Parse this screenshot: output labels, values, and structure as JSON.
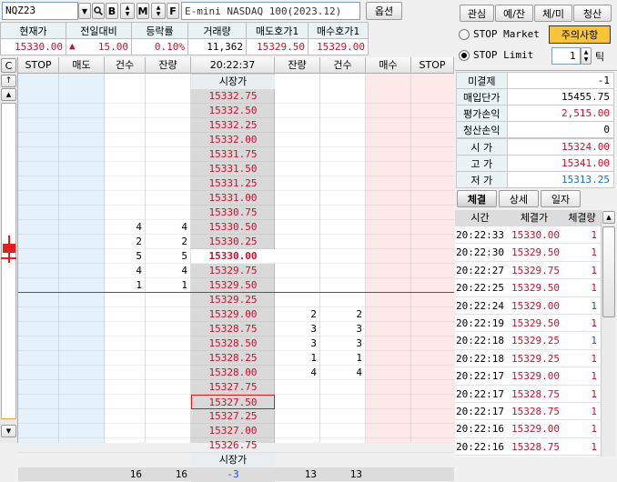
{
  "toolbar": {
    "symbol": "NQZ23",
    "name": "E-mini NASDAQ 100(2023.12)",
    "options_label": "옵션",
    "btn_b": "B",
    "btn_m": "M",
    "btn_f": "F"
  },
  "quote": {
    "headers": [
      "현재가",
      "전일대비",
      "등락률",
      "거래량",
      "매도호가1",
      "매수호가1"
    ],
    "current": "15330.00",
    "change": "15.00",
    "change_dir_icon": "up-triangle-icon",
    "rate": "0.10%",
    "volume": "11,362",
    "ask1": "15329.50",
    "bid1": "15329.00"
  },
  "ladder": {
    "corner": "C",
    "time": "20:22:37",
    "headers": [
      "STOP",
      "매도",
      "건수",
      "잔량",
      "",
      "잔량",
      "건수",
      "매수",
      "STOP"
    ],
    "market_label": "시장가",
    "prices": [
      "15332.75",
      "15332.50",
      "15332.25",
      "15332.00",
      "15331.75",
      "15331.50",
      "15331.25",
      "15331.00",
      "15330.75",
      "15330.50",
      "15330.25",
      "15330.00",
      "15329.75",
      "15329.50",
      "15329.25",
      "15329.00",
      "15328.75",
      "15328.50",
      "15328.25",
      "15328.00",
      "15327.75",
      "15327.50",
      "15327.25",
      "15327.00",
      "15326.75"
    ],
    "ask_rows": [
      {
        "row": 9,
        "count": "4",
        "qty": "4"
      },
      {
        "row": 10,
        "count": "2",
        "qty": "2"
      },
      {
        "row": 11,
        "count": "5",
        "qty": "5"
      },
      {
        "row": 12,
        "count": "4",
        "qty": "4"
      },
      {
        "row": 13,
        "count": "1",
        "qty": "1"
      }
    ],
    "bid_rows": [
      {
        "row": 15,
        "qty": "2",
        "count": "2"
      },
      {
        "row": 16,
        "qty": "3",
        "count": "3"
      },
      {
        "row": 17,
        "qty": "3",
        "count": "3"
      },
      {
        "row": 18,
        "qty": "1",
        "count": "1"
      },
      {
        "row": 19,
        "qty": "4",
        "count": "4"
      }
    ],
    "current_row": 11,
    "highlight_row": 21,
    "totals": {
      "ask_count": "16",
      "ask_qty": "16",
      "net": "-3",
      "bid_qty": "13",
      "bid_count": "13"
    }
  },
  "side": {
    "tabs": [
      "관심",
      "예/잔",
      "체/미",
      "청산"
    ],
    "stop_market": "STOP Market",
    "stop_limit": "STOP Limit",
    "notice": "주의사항",
    "tick_value": "1",
    "tick_label": "틱",
    "account": [
      {
        "label": "미결제",
        "value": "-1",
        "color": "#000000"
      },
      {
        "label": "매입단가",
        "value": "15455.75",
        "color": "#000000"
      },
      {
        "label": "평가손익",
        "value": "2,515.00",
        "color": "#c8102e"
      },
      {
        "label": "청산손익",
        "value": "0",
        "color": "#000000"
      }
    ],
    "ohl": [
      {
        "label": "시 가",
        "value": "15324.00",
        "color": "#c8102e"
      },
      {
        "label": "고 가",
        "value": "15341.00",
        "color": "#c8102e"
      },
      {
        "label": "저 가",
        "value": "15313.25",
        "color": "#1a6fb0"
      }
    ],
    "trade_tabs": [
      "체결",
      "상세",
      "일자"
    ],
    "trade_headers": [
      "시간",
      "체결가",
      "체결량"
    ],
    "trades": [
      {
        "time": "20:22:33",
        "price": "15330.00",
        "qty": "1",
        "qcolor": "#c8102e"
      },
      {
        "time": "20:22:30",
        "price": "15329.50",
        "qty": "1",
        "qcolor": "#c8102e"
      },
      {
        "time": "20:22:27",
        "price": "15329.75",
        "qty": "1",
        "qcolor": "#c8102e"
      },
      {
        "time": "20:22:25",
        "price": "15329.50",
        "qty": "1",
        "qcolor": "#c8102e"
      },
      {
        "time": "20:22:24",
        "price": "15329.00",
        "qty": "1",
        "qcolor": "#1a4fd6"
      },
      {
        "time": "20:22:19",
        "price": "15329.50",
        "qty": "1",
        "qcolor": "#c8102e"
      },
      {
        "time": "20:22:18",
        "price": "15329.25",
        "qty": "1",
        "qcolor": "#1a4fd6"
      },
      {
        "time": "20:22:18",
        "price": "15329.25",
        "qty": "1",
        "qcolor": "#c8102e"
      },
      {
        "time": "20:22:17",
        "price": "15329.00",
        "qty": "1",
        "qcolor": "#c8102e"
      },
      {
        "time": "20:22:17",
        "price": "15328.75",
        "qty": "1",
        "qcolor": "#c8102e"
      },
      {
        "time": "20:22:17",
        "price": "15328.75",
        "qty": "1",
        "qcolor": "#c8102e"
      },
      {
        "time": "20:22:16",
        "price": "15329.00",
        "qty": "1",
        "qcolor": "#c8102e"
      },
      {
        "time": "20:22:16",
        "price": "15328.75",
        "qty": "1",
        "qcolor": "#c8102e"
      }
    ]
  }
}
